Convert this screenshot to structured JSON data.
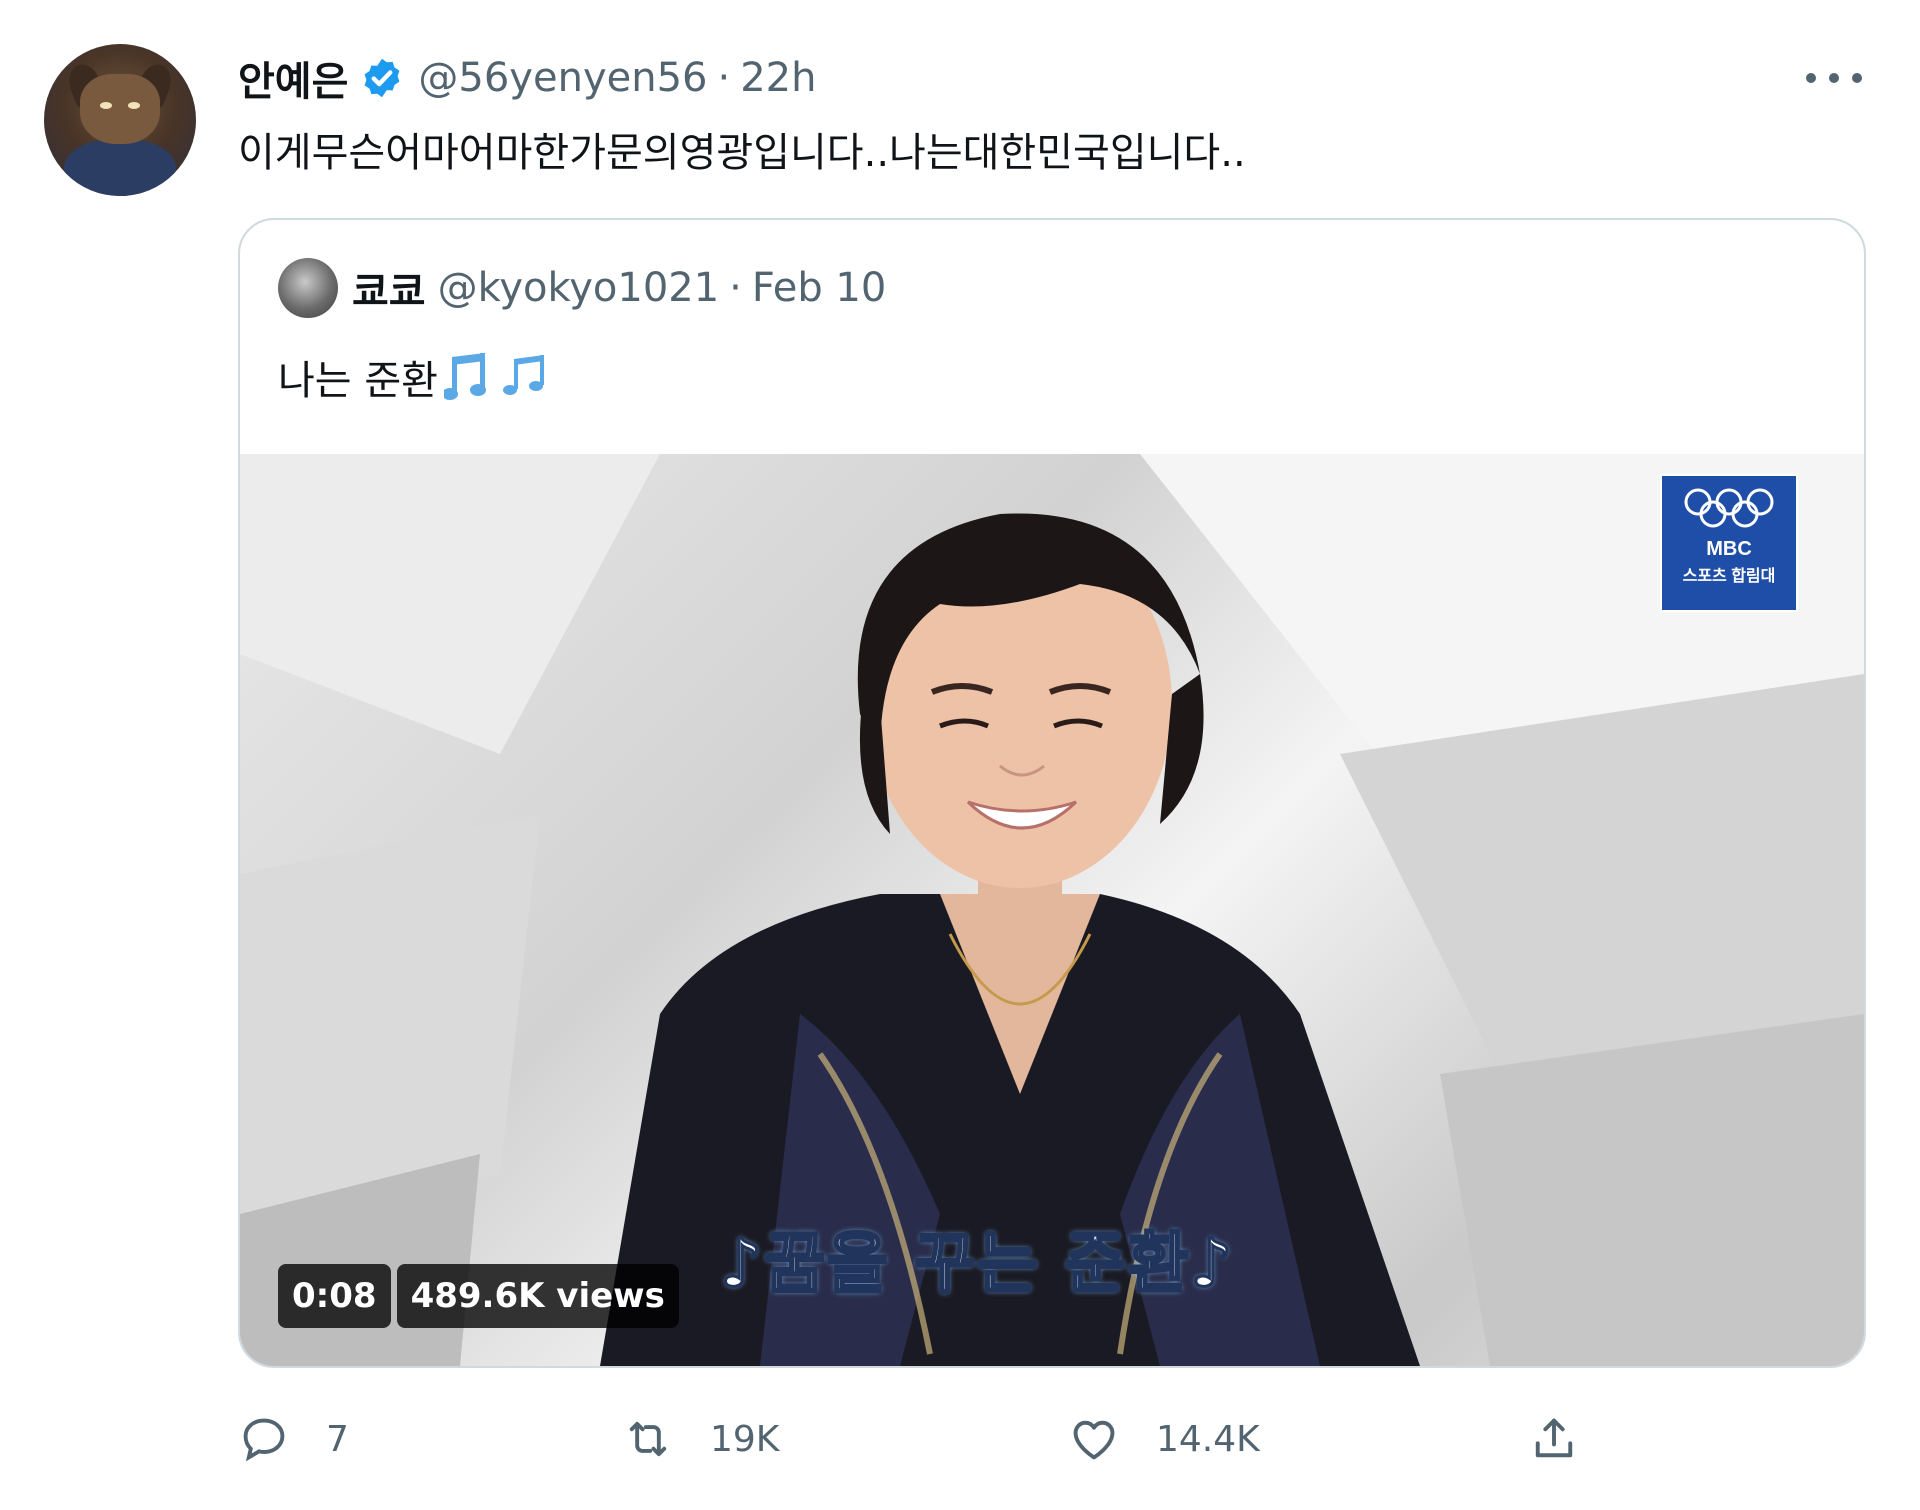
{
  "tweet": {
    "author_name": "안예은",
    "handle": "@56yenyen56",
    "separator": "·",
    "time": "22h",
    "text": "이게무슨어마어마한가문의영광입니다..나는대한민국입니다..",
    "verified": true
  },
  "quote": {
    "author_name": "쿄쿄",
    "handle": "@kyokyo1021",
    "separator": "·",
    "time": "Feb 10",
    "text": "나는 준환",
    "emoji_icon": "musical-notes-icon",
    "media": {
      "logo_line1": "MBC",
      "logo_line2": "스포츠 합림대",
      "caption_pre": "꿈을 꾸는 ",
      "caption_name": "준환",
      "duration": "0:08",
      "views": "489.6K views"
    }
  },
  "actions": {
    "reply_count": "7",
    "retweet_count": "19K",
    "like_count": "14.4K"
  },
  "colors": {
    "accent": "#1d9bf0",
    "secondary_text": "#536471",
    "border": "#cfd9de"
  }
}
